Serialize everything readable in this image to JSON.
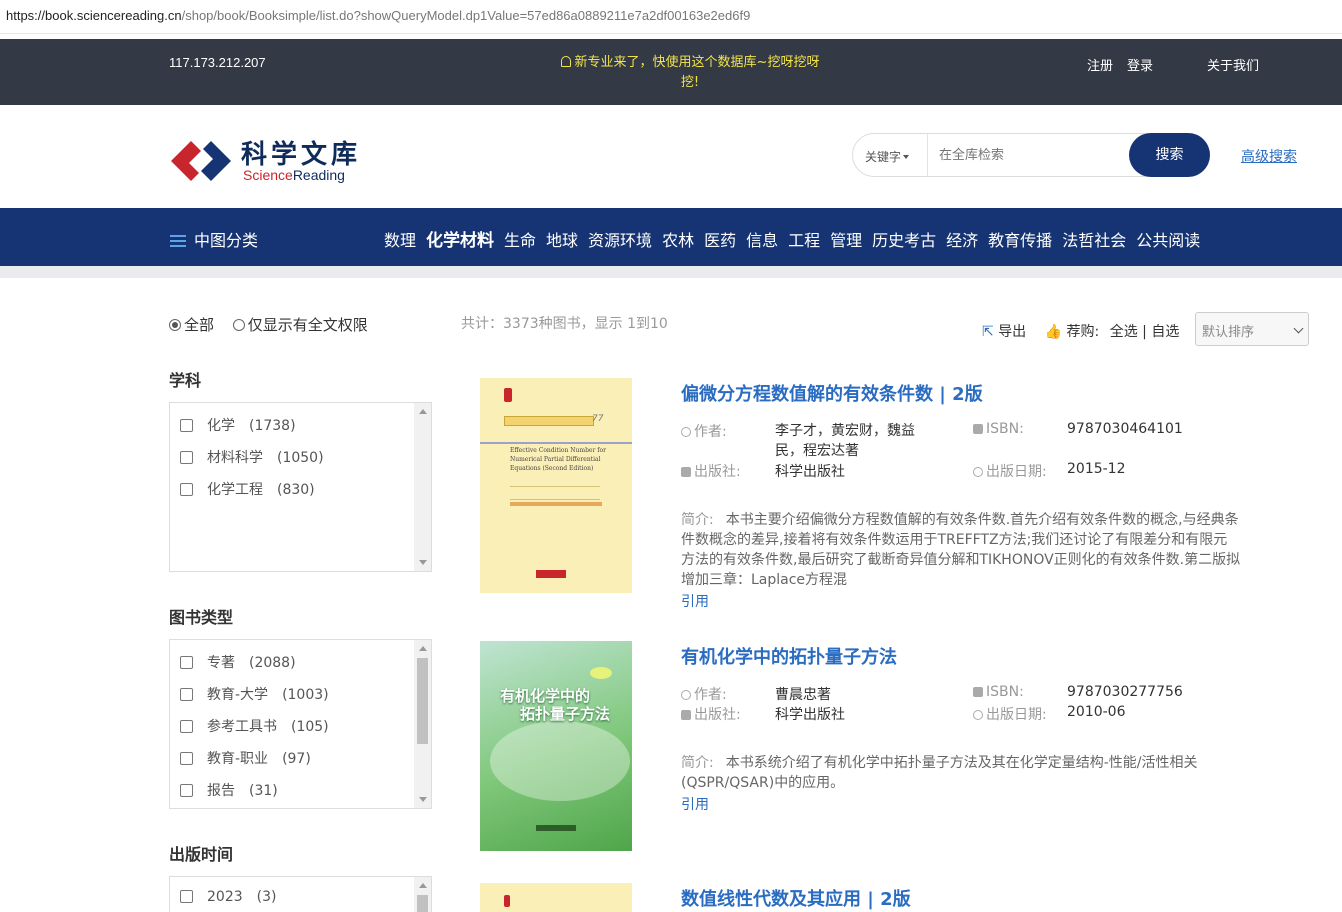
{
  "browser": {
    "url_host": "https://book.sciencereading.cn",
    "url_path": "/shop/book/Booksimple/list.do?showQueryModel.dp1Value=57ed86a0889211e7a2df00163e2ed6f9"
  },
  "topbar": {
    "ip": "117.173.212.207",
    "notice_line1": "新专业来了，快使用这个数据库~挖呀挖呀",
    "notice_line2": "挖!",
    "register": "注册",
    "login": "登录",
    "about": "关于我们"
  },
  "logo": {
    "cn": "科学文库",
    "en_a": "Science",
    "en_b": "Reading"
  },
  "search": {
    "scope": "关键字",
    "placeholder": "在全库检索",
    "button": "搜索",
    "advanced": "高级搜索"
  },
  "nav": {
    "classification": "中图分类",
    "items": [
      "数理",
      "化学材料",
      "生命",
      "地球",
      "资源环境",
      "农林",
      "医药",
      "信息",
      "工程",
      "管理",
      "历史考古",
      "经济",
      "教育传播",
      "法哲社会",
      "公共阅读"
    ],
    "active_index": 1
  },
  "filters": {
    "radio_all": "全部",
    "radio_fulltext": "仅显示有全文权限",
    "subject_title": "学科",
    "subjects": [
      {
        "label": "化学",
        "count": "(1738)"
      },
      {
        "label": "材料科学",
        "count": "(1050)"
      },
      {
        "label": "化学工程",
        "count": "(830)"
      }
    ],
    "type_title": "图书类型",
    "types": [
      {
        "label": "专著",
        "count": "(2088)"
      },
      {
        "label": "教育-大学",
        "count": "(1003)"
      },
      {
        "label": "参考工具书",
        "count": "(105)"
      },
      {
        "label": "教育-职业",
        "count": "(97)"
      },
      {
        "label": "报告",
        "count": "(31)"
      }
    ],
    "year_title": "出版时间",
    "years": [
      {
        "label": "2023",
        "count": "(3)"
      }
    ]
  },
  "results": {
    "total": "共计：3373种图书，显示 1到10",
    "export": "导出",
    "recommend": "荐购:",
    "select_all": "全选",
    "select_self": "自选",
    "sort": "默认排序"
  },
  "labels": {
    "author": "作者:",
    "publisher": "出版社:",
    "isbn": "ISBN:",
    "pubdate": "出版日期:",
    "summary": "简介:",
    "cite": "引用"
  },
  "books": [
    {
      "title": "偏微分方程数值解的有效条件数 | 2版",
      "author": "李子才，黄宏财，魏益民，程宏达著",
      "publisher": "科学出版社",
      "isbn": "9787030464101",
      "date": "2015-12",
      "summary": "本书主要介绍偏微分方程数值解的有效条件数.首先介绍有效条件数的概念,与经典条件数概念的差异,接着将有效条件数运用于TREFFTZ方法;我们还讨论了有限差分和有限元方法的有效条件数,最后研究了截断奇异值分解和TIKHONOV正则化的有效条件数.第二版拟增加三章：Laplace方程混",
      "cover_en": "Effective Condition Number for Numerical Partial Differential Equations (Second Edition)",
      "cover_series_no": "77"
    },
    {
      "title": "有机化学中的拓扑量子方法",
      "author": "曹晨忠著",
      "publisher": "科学出版社",
      "isbn": "9787030277756",
      "date": "2010-06",
      "summary": "本书系统介绍了有机化学中拓扑量子方法及其在化学定量结构-性能/活性相关(QSPR/QSAR)中的应用。",
      "cover_cn_line1": "有机化学中的",
      "cover_cn_line2": "拓扑量子方法"
    },
    {
      "title": "数值线性代数及其应用 | 2版"
    }
  ],
  "colors": {
    "topbar": "#333a46",
    "notice": "#f3e34a",
    "nav": "#163473",
    "link": "#2a6cc1"
  }
}
